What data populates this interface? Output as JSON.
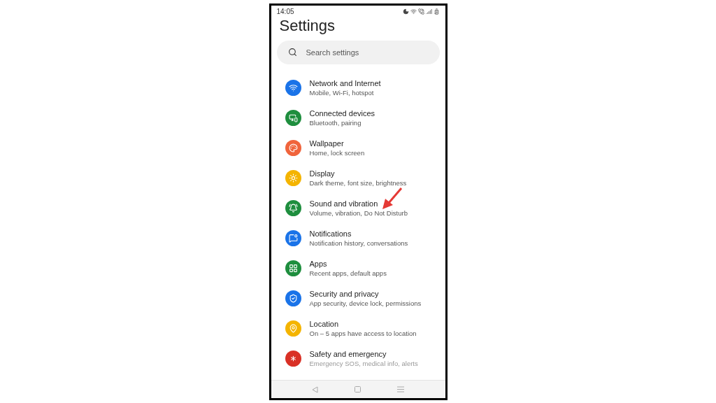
{
  "status_bar": {
    "time": "14:05"
  },
  "title": "Settings",
  "search": {
    "placeholder": "Search settings"
  },
  "items": [
    {
      "color": "#1a73e8",
      "title": "Network and Internet",
      "subtitle": "Mobile, Wi-Fi, hotspot"
    },
    {
      "color": "#1e8e3e",
      "title": "Connected devices",
      "subtitle": "Bluetooth, pairing"
    },
    {
      "color": "#f0643c",
      "title": "Wallpaper",
      "subtitle": "Home, lock screen"
    },
    {
      "color": "#f4b400",
      "title": "Display",
      "subtitle": "Dark theme, font size, brightness"
    },
    {
      "color": "#1e8e3e",
      "title": "Sound and vibration",
      "subtitle": "Volume, vibration, Do Not Disturb"
    },
    {
      "color": "#1a73e8",
      "title": "Notifications",
      "subtitle": "Notification history, conversations"
    },
    {
      "color": "#1e8e3e",
      "title": "Apps",
      "subtitle": "Recent apps, default apps"
    },
    {
      "color": "#1a73e8",
      "title": "Security and privacy",
      "subtitle": "App security, device lock, permissions"
    },
    {
      "color": "#f4b400",
      "title": "Location",
      "subtitle": "On – 5 apps have access to location"
    },
    {
      "color": "#d93025",
      "title": "Safety and emergency",
      "subtitle": "Emergency SOS, medical info, alerts"
    }
  ]
}
